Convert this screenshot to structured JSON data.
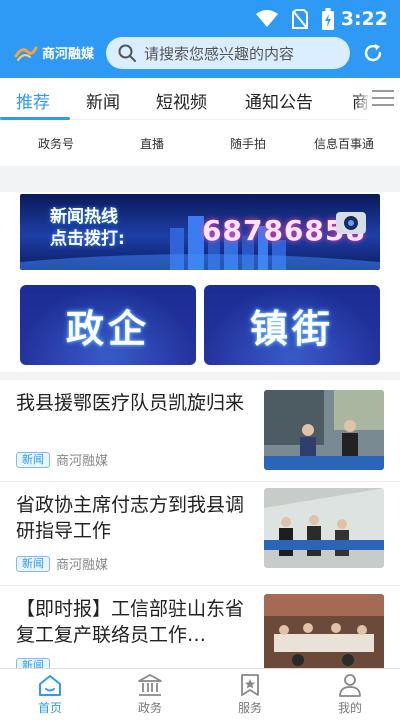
{
  "status_bar": {
    "time": "3:22"
  },
  "header": {
    "logo_text": "商河融媒",
    "search_placeholder": "请搜索您感兴趣的内容"
  },
  "tabs": [
    {
      "label": "推荐",
      "active": true
    },
    {
      "label": "新闻",
      "active": false
    },
    {
      "label": "短视频",
      "active": false
    },
    {
      "label": "通知公告",
      "active": false
    },
    {
      "label": "商",
      "active": false
    }
  ],
  "quick_links": [
    "政务号",
    "直播",
    "随手拍",
    "信息百事通"
  ],
  "banner": {
    "hotline_label_line1": "新闻热线",
    "hotline_label_line2": "点击拨打:",
    "hotline_number": "68786858"
  },
  "gov_buttons": [
    "政企",
    "镇街"
  ],
  "news": [
    {
      "title": "我县援鄂医疗队员凯旋归来",
      "badge": "新闻",
      "source": "商河融媒"
    },
    {
      "title": "省政协主席付志方到我县调研指导工作",
      "badge": "新闻",
      "source": "商河融媒"
    },
    {
      "title": "【即时报】工信部驻山东省复工复产联络员工作…",
      "badge": "新闻",
      "source": ""
    }
  ],
  "bottom_nav": [
    {
      "label": "首页",
      "icon": "home-icon",
      "active": true
    },
    {
      "label": "政务",
      "icon": "government-icon",
      "active": false
    },
    {
      "label": "服务",
      "icon": "bookmark-star-icon",
      "active": false
    },
    {
      "label": "我的",
      "icon": "user-icon",
      "active": false
    }
  ],
  "colors": {
    "primary": "#2f9af6",
    "banner_dark": "#1c2d95"
  }
}
